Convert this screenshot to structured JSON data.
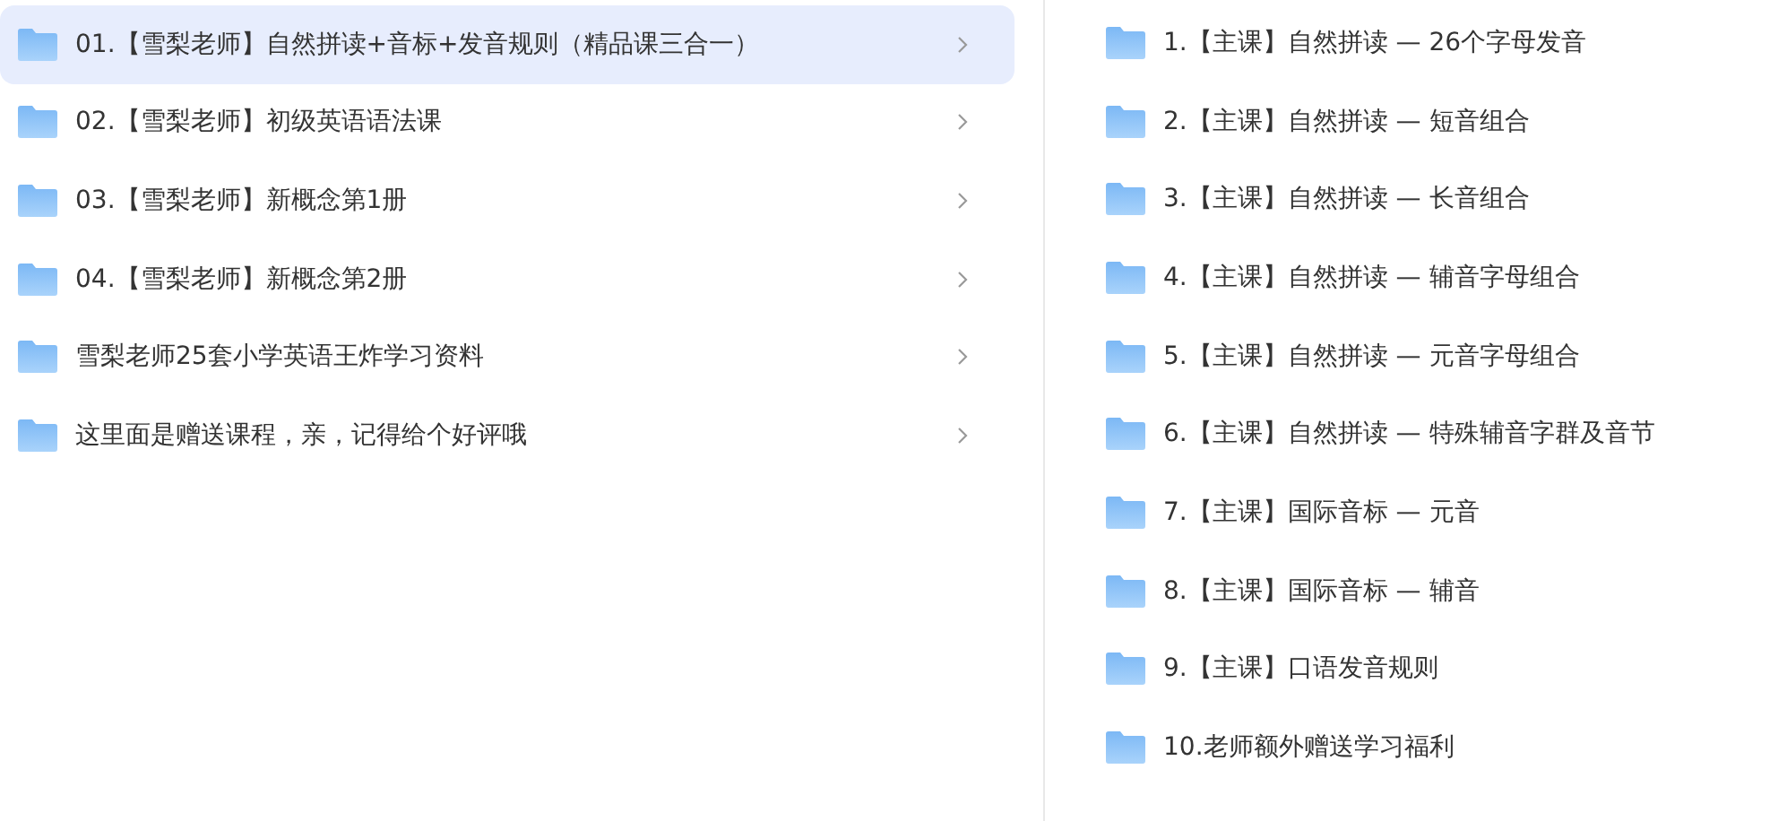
{
  "folders": [
    {
      "name": "01.【雪梨老师】自然拼读+音标+发音规则（精品课三合一）",
      "selected": true
    },
    {
      "name": "02.【雪梨老师】初级英语语法课",
      "selected": false
    },
    {
      "name": "03.【雪梨老师】新概念第1册",
      "selected": false
    },
    {
      "name": "04.【雪梨老师】新概念第2册",
      "selected": false
    },
    {
      "name": "雪梨老师25套小学英语王炸学习资料",
      "selected": false
    },
    {
      "name": "这里面是赠送课程，亲，记得给个好评哦",
      "selected": false
    }
  ],
  "subfolders": [
    {
      "name": "1.【主课】自然拼读 — 26个字母发音"
    },
    {
      "name": "2.【主课】自然拼读 — 短音组合"
    },
    {
      "name": "3.【主课】自然拼读 — 长音组合"
    },
    {
      "name": "4.【主课】自然拼读 — 辅音字母组合"
    },
    {
      "name": "5.【主课】自然拼读 — 元音字母组合"
    },
    {
      "name": "6.【主课】自然拼读 — 特殊辅音字群及音节"
    },
    {
      "name": "7.【主课】国际音标 — 元音"
    },
    {
      "name": "8.【主课】国际音标 — 辅音"
    },
    {
      "name": "9.【主课】口语发音规则"
    },
    {
      "name": "10.老师额外赠送学习福利"
    }
  ]
}
